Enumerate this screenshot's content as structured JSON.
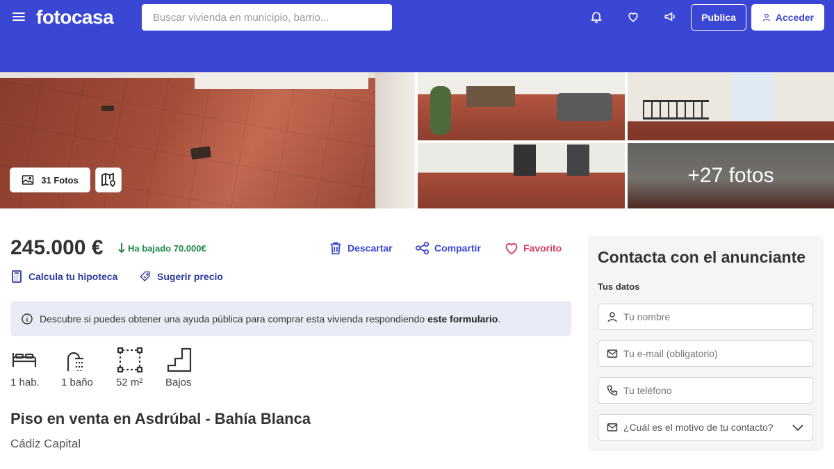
{
  "header": {
    "logo": "fotocasa",
    "search_placeholder": "Buscar vivienda en municipio, barrio...",
    "publica_label": "Publica",
    "acceder_label": "Acceder",
    "bg_color": "#3a47d4",
    "icons": [
      "bell-icon",
      "heart-icon",
      "megaphone-icon"
    ]
  },
  "gallery": {
    "photos_label": "31 Fotos",
    "more_label": "+27 fotos"
  },
  "listing": {
    "price": "245.000 €",
    "price_drop": "Ha bajado 70.000€",
    "actions": {
      "discard": "Descartar",
      "share": "Compartir",
      "favorite": "Favorito"
    },
    "links": {
      "mortgage": "Calcula tu hipoteca",
      "suggest_price": "Sugerir precio"
    },
    "banner": {
      "text": "Descubre si puedes obtener una ayuda pública para comprar esta vivienda respondiendo",
      "link": "este formulario",
      "end": "."
    },
    "features": [
      {
        "icon": "bed-icon",
        "label": "1 hab."
      },
      {
        "icon": "shower-icon",
        "label": "1 baño"
      },
      {
        "icon": "area-icon",
        "label": "52 m²"
      },
      {
        "icon": "stairs-icon",
        "label": "Bajos"
      }
    ],
    "title": "Piso en venta en Asdrúbal - Bahía Blanca",
    "location": "Cádiz Capital"
  },
  "contact": {
    "heading": "Contacta con el anunciante",
    "section_label": "Tus datos",
    "name_placeholder": "Tu nombre",
    "email_placeholder": "Tu e-mail (obligatorio)",
    "phone_placeholder": "Tu teléfono",
    "reason_placeholder": "¿Cuál es el motivo de tu contacto?"
  },
  "colors": {
    "accent": "#3a47d4",
    "price_drop": "#1f8a4a",
    "favorite": "#d63b5e"
  }
}
